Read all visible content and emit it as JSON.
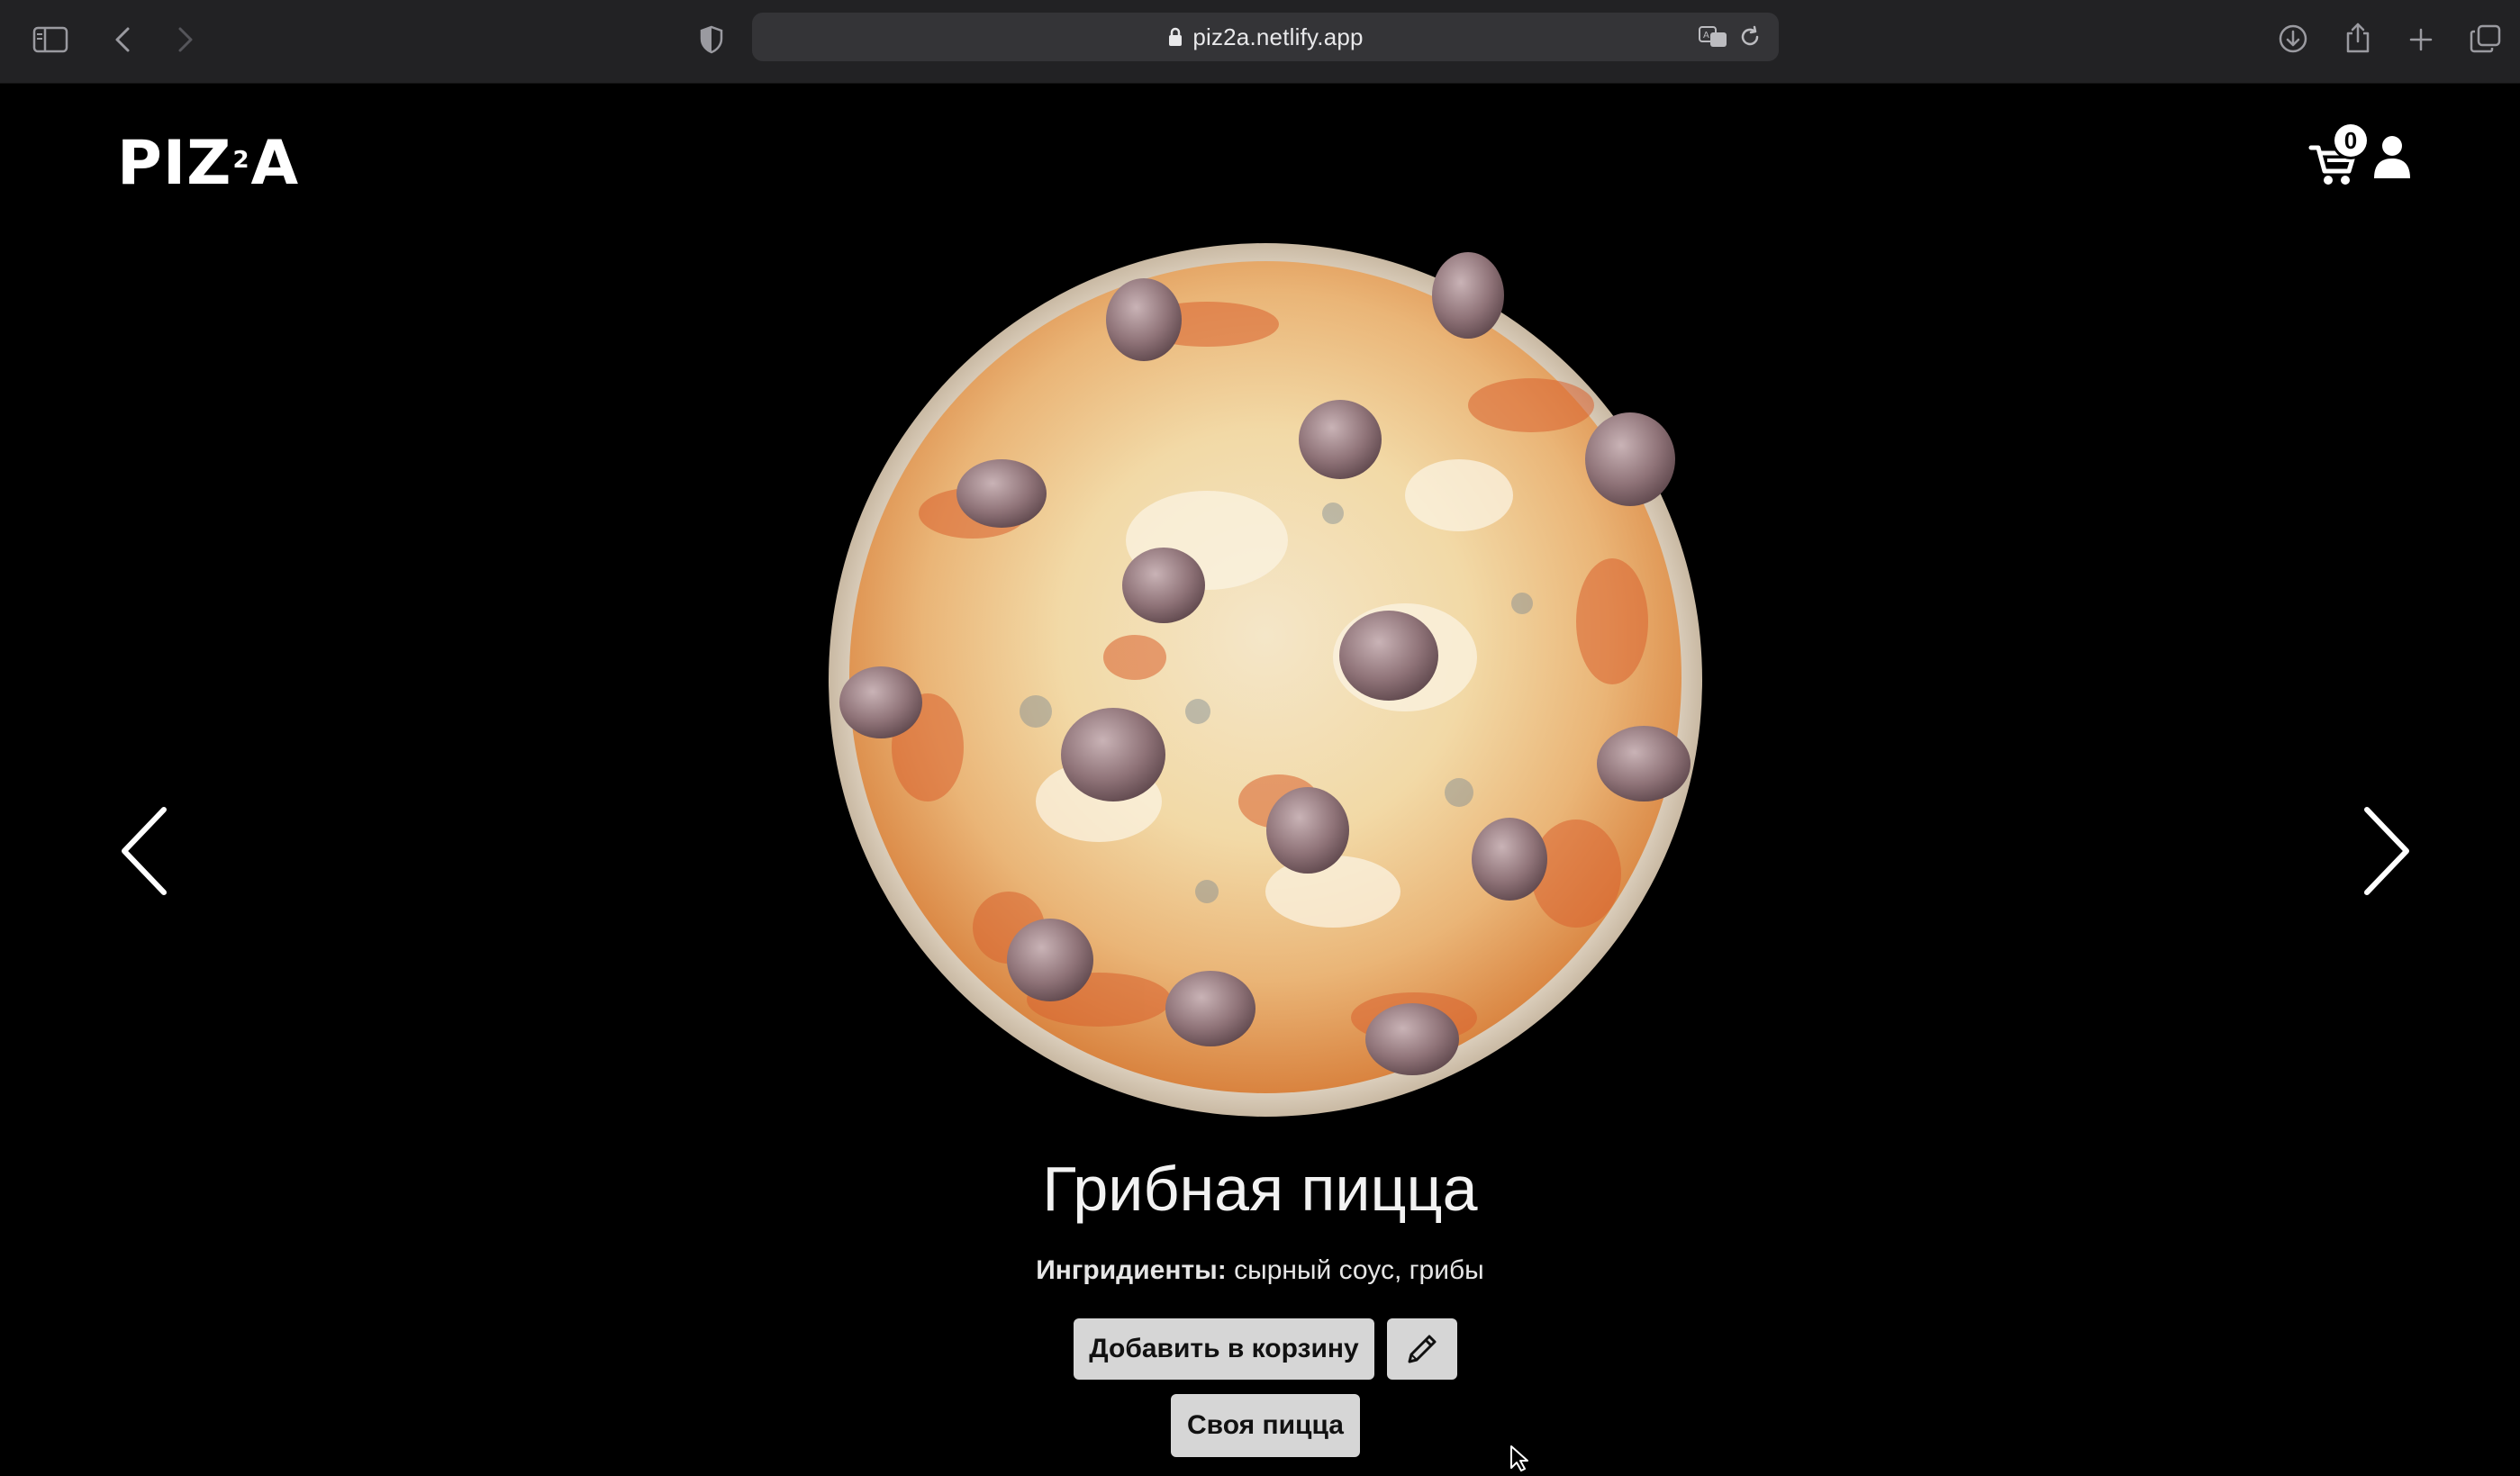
{
  "browser": {
    "url": "piz2a.netlify.app"
  },
  "header": {
    "logo_left": "PIZ",
    "logo_sup": "2",
    "logo_right": "A",
    "cart_count": "0"
  },
  "product": {
    "title": "Грибная пицца",
    "ingredients_label": "Ингридиенты:",
    "ingredients_value": "сырный соус, грибы",
    "add_to_cart_label": "Добавить в корзину",
    "custom_pizza_label": "Своя пицца"
  },
  "colors": {
    "page_background": "#000000",
    "button_background": "#d6d6d6",
    "chrome_background": "#222224"
  },
  "icons": {
    "sidebar": "sidebar-icon",
    "back": "chevron-left-icon",
    "forward": "chevron-right-icon",
    "shield": "shield-icon",
    "lock": "lock-icon",
    "translate": "translate-icon",
    "reload": "reload-icon",
    "download": "download-icon",
    "share": "share-icon",
    "new_tab": "plus-icon",
    "tabs": "tabs-icon",
    "cart": "cart-icon",
    "user": "user-icon",
    "edit": "pencil-icon",
    "prev": "arrow-left-icon",
    "next": "arrow-right-icon"
  }
}
